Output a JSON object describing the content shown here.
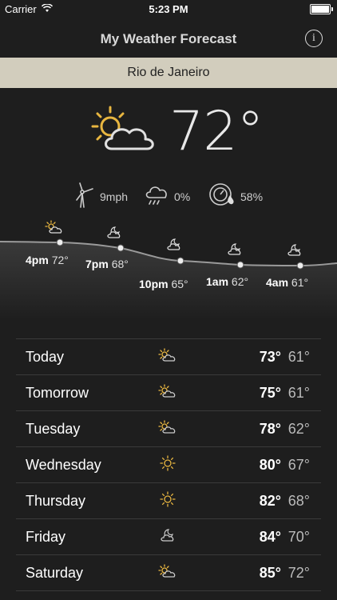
{
  "status_bar": {
    "carrier": "Carrier",
    "time": "5:23 PM"
  },
  "nav": {
    "title": "My Weather Forecast",
    "info_label": "i"
  },
  "location": {
    "city": "Rio de Janeiro"
  },
  "current": {
    "temperature": "72°",
    "icon": "partly-sunny-icon",
    "wind": "9mph",
    "precipitation": "0%",
    "humidity": "58%"
  },
  "hourly": [
    {
      "hour": "4pm",
      "temp": "72°",
      "icon": "partly-sunny-icon"
    },
    {
      "hour": "7pm",
      "temp": "68°",
      "icon": "night-cloudy-icon"
    },
    {
      "hour": "10pm",
      "temp": "65°",
      "icon": "night-cloudy-icon"
    },
    {
      "hour": "1am",
      "temp": "62°",
      "icon": "night-cloudy-icon"
    },
    {
      "hour": "4am",
      "temp": "61°",
      "icon": "night-cloudy-icon"
    }
  ],
  "daily": [
    {
      "day": "Today",
      "high": "73°",
      "low": "61°",
      "icon": "partly-sunny-icon"
    },
    {
      "day": "Tomorrow",
      "high": "75°",
      "low": "61°",
      "icon": "partly-sunny-icon"
    },
    {
      "day": "Tuesday",
      "high": "78°",
      "low": "62°",
      "icon": "partly-sunny-icon"
    },
    {
      "day": "Wednesday",
      "high": "80°",
      "low": "67°",
      "icon": "sun-icon"
    },
    {
      "day": "Thursday",
      "high": "82°",
      "low": "68°",
      "icon": "sun-icon"
    },
    {
      "day": "Friday",
      "high": "84°",
      "low": "70°",
      "icon": "night-cloudy-icon"
    },
    {
      "day": "Saturday",
      "high": "85°",
      "low": "72°",
      "icon": "partly-sunny-icon"
    }
  ],
  "colors": {
    "accent_sun": "#e8b640",
    "city_bar": "#d2cdbd",
    "background": "#1e1e1e"
  }
}
